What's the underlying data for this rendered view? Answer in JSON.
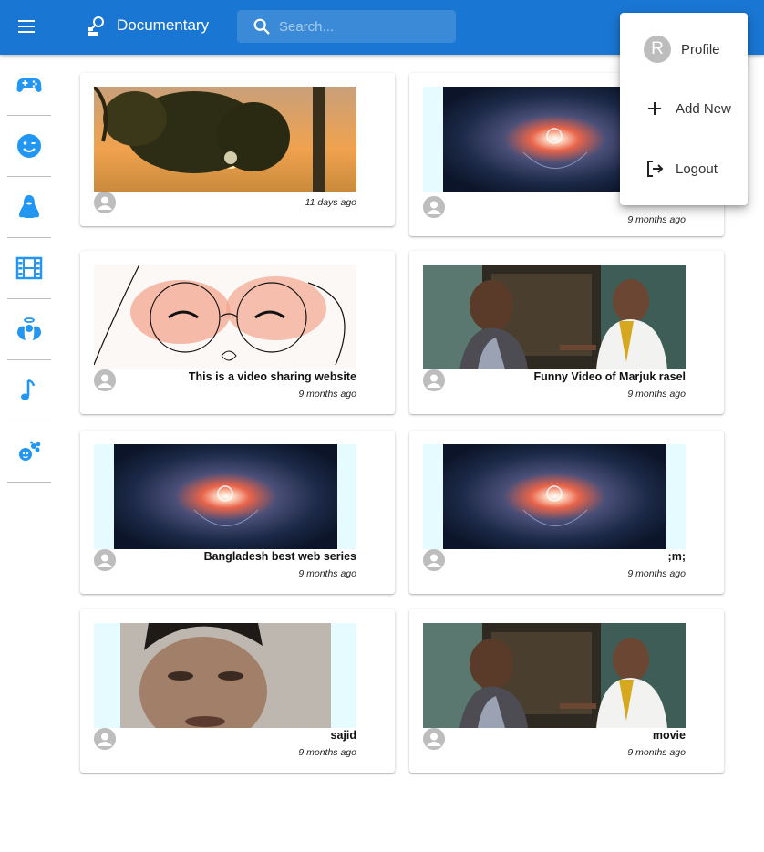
{
  "header": {
    "brand": "Documentary",
    "search_placeholder": "Search..."
  },
  "sidebar": {
    "items": [
      {
        "icon": "gamepad-icon"
      },
      {
        "icon": "smiley-icon"
      },
      {
        "icon": "penguin-icon"
      },
      {
        "icon": "film-icon"
      },
      {
        "icon": "angel-icon"
      },
      {
        "icon": "music-note-icon"
      },
      {
        "icon": "baby-icon"
      }
    ]
  },
  "user_menu": {
    "avatar_letter": "R",
    "items": [
      {
        "label": "Profile"
      },
      {
        "label": "Add New"
      },
      {
        "label": "Logout"
      }
    ]
  },
  "videos": [
    {
      "title": "",
      "time": "11 days ago",
      "thumb": "sunset-trees"
    },
    {
      "title": "",
      "time": "9 months ago",
      "thumb": "lens-glow"
    },
    {
      "title": "This is a video sharing website",
      "time": "9 months ago",
      "thumb": "sketch-faces"
    },
    {
      "title": "Funny Video of Marjuk rasel",
      "time": "9 months ago",
      "thumb": "drama-scene"
    },
    {
      "title": "Bangladesh best web series",
      "time": "9 months ago",
      "thumb": "lens-glow"
    },
    {
      "title": ";m;",
      "time": "9 months ago",
      "thumb": "lens-glow"
    },
    {
      "title": "sajid",
      "time": "9 months ago",
      "thumb": "selfie"
    },
    {
      "title": "movie",
      "time": "9 months ago",
      "thumb": "drama-scene"
    }
  ],
  "colors": {
    "appbar": "#1976d2",
    "sidebar_icon": "#2196f3"
  }
}
